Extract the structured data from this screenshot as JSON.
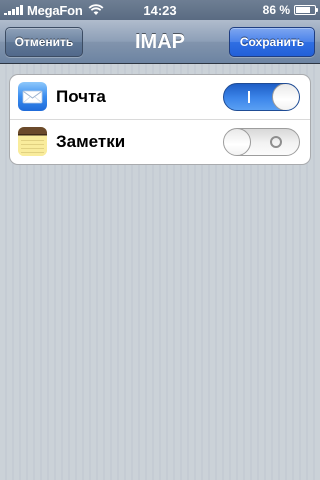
{
  "status_bar": {
    "carrier": "MegaFon",
    "time": "14:23",
    "battery_percent": "86 %",
    "battery_level": 0.86,
    "signal_bars": 5,
    "icons": [
      "signal-icon",
      "wifi-icon",
      "battery-icon"
    ]
  },
  "nav": {
    "title": "IMAP",
    "cancel_label": "Отменить",
    "save_label": "Сохранить"
  },
  "settings": {
    "rows": [
      {
        "label": "Почта",
        "icon": "mail-app-icon",
        "enabled": true
      },
      {
        "label": "Заметки",
        "icon": "notes-app-icon",
        "enabled": false
      }
    ]
  },
  "colors": {
    "nav_bar": "#6d84a2",
    "save_button": "#2f6ee3",
    "toggle_on": "#3d86ea",
    "background": "#c5ccd4"
  }
}
